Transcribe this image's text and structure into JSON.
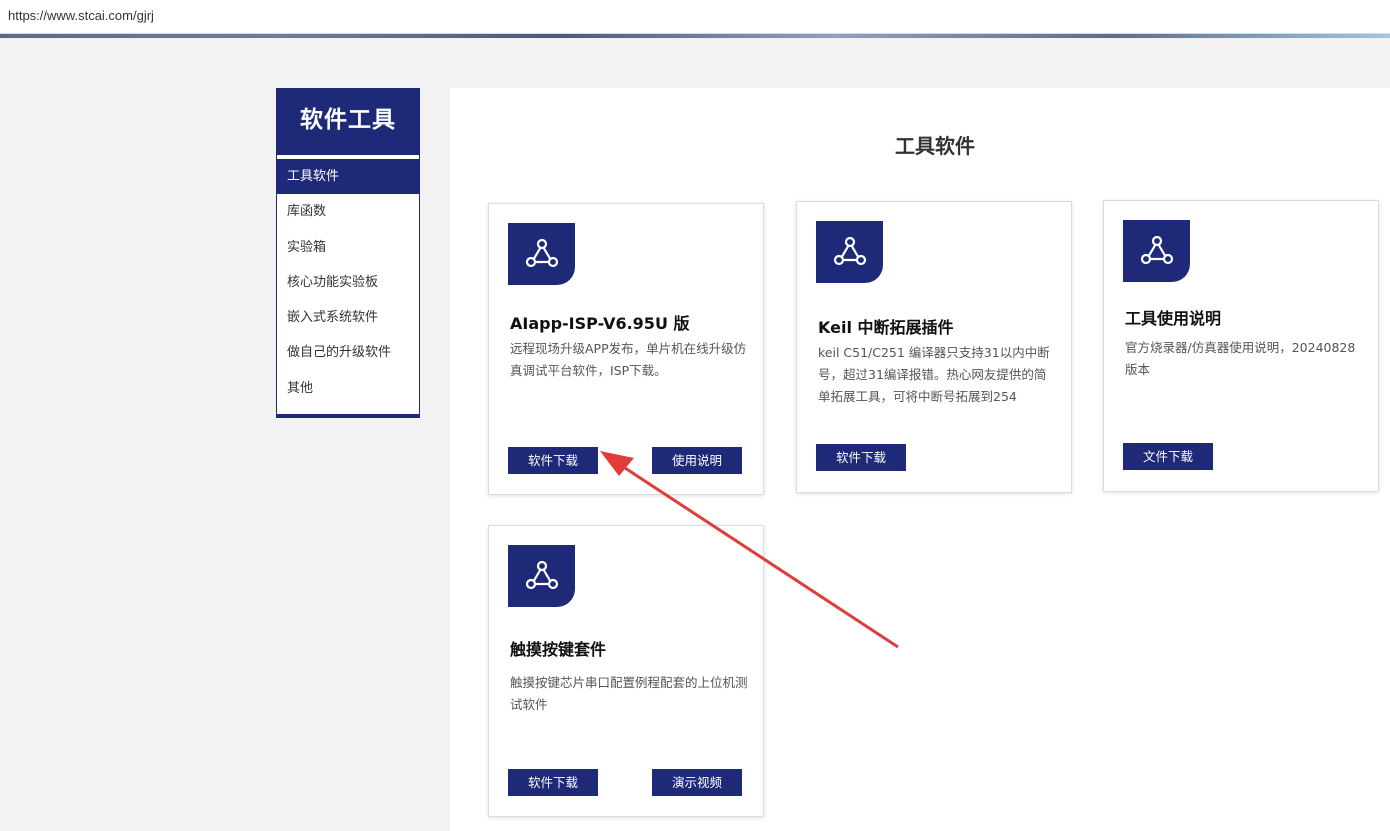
{
  "browser": {
    "url": "https://www.stcai.com/gjrj"
  },
  "sidebar": {
    "title": "软件工具",
    "items": [
      {
        "label": "工具软件",
        "active": true
      },
      {
        "label": "库函数"
      },
      {
        "label": "实验箱"
      },
      {
        "label": "核心功能实验板"
      },
      {
        "label": "嵌入式系统软件"
      },
      {
        "label": "做自己的升级软件"
      },
      {
        "label": "其他"
      }
    ]
  },
  "main": {
    "title": "工具软件",
    "cards": [
      {
        "icon": "network-triangle-icon",
        "name": "AIapp-ISP-V6.95U 版",
        "description": "远程现场升级APP发布，单片机在线升级仿真调试平台软件，ISP下载。",
        "buttons": [
          "软件下载",
          "使用说明"
        ]
      },
      {
        "icon": "network-triangle-icon",
        "name": "Keil 中断拓展插件",
        "description": "keil C51/C251 编译器只支持31以内中断号，超过31编译报错。热心网友提供的简单拓展工具，可将中断号拓展到254",
        "buttons": [
          "软件下载"
        ]
      },
      {
        "icon": "network-triangle-icon",
        "name": "工具使用说明",
        "description": "官方烧录器/仿真器使用说明，20240828版本",
        "buttons": [
          "文件下载"
        ]
      },
      {
        "icon": "network-triangle-icon",
        "name": "触摸按键套件",
        "description": "触摸按键芯片串口配置例程配套的上位机测试软件",
        "buttons": [
          "软件下载",
          "演示视频"
        ]
      }
    ]
  },
  "annotation": {
    "color": "#e03c3c"
  }
}
